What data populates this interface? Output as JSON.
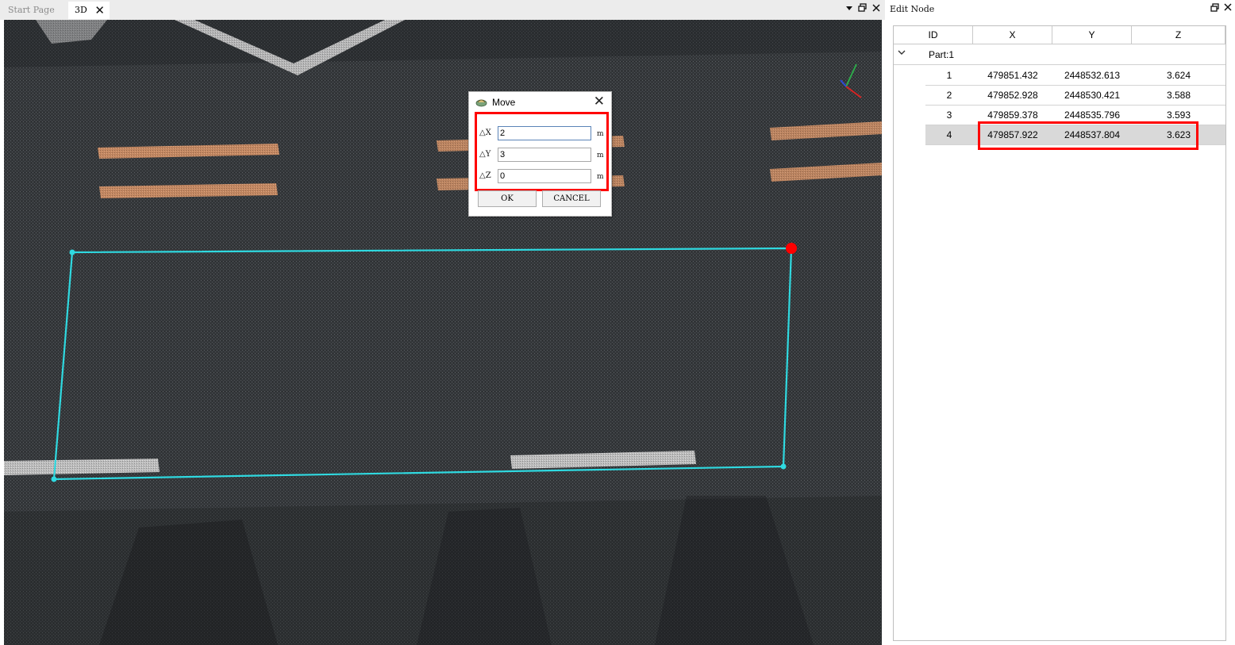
{
  "tabs": [
    {
      "label": "Start Page",
      "active": false
    },
    {
      "label": "3D",
      "active": true
    }
  ],
  "tab_close_glyph": "✕",
  "window_controls": {
    "dropdown_icon": "dropdown-arrow-icon",
    "restore_icon": "restore-window-icon",
    "close_icon": "close-icon"
  },
  "viewport": {
    "background_color": "#2f3134",
    "polygon_color": "#2fd9e0",
    "selected_vertex_color": "#ff0000",
    "marking_colors": {
      "orange": "#d6946b",
      "white": "#cfcfcf"
    }
  },
  "move_dialog": {
    "title": "Move",
    "fields": [
      {
        "label": "△X",
        "value": "2",
        "unit": "m"
      },
      {
        "label": "△Y",
        "value": "3",
        "unit": "m"
      },
      {
        "label": "△Z",
        "value": "0",
        "unit": "m"
      }
    ],
    "ok_label": "OK",
    "cancel_label": "CANCEL",
    "close_glyph": "✕"
  },
  "edit_node_panel": {
    "title": "Edit Node",
    "columns": [
      "ID",
      "X",
      "Y",
      "Z"
    ],
    "part_label": "Part:1",
    "rows": [
      {
        "id": "1",
        "x": "479851.432",
        "y": "2448532.613",
        "z": "3.624",
        "selected": false
      },
      {
        "id": "2",
        "x": "479852.928",
        "y": "2448530.421",
        "z": "3.588",
        "selected": false
      },
      {
        "id": "3",
        "x": "479859.378",
        "y": "2448535.796",
        "z": "3.593",
        "selected": false
      },
      {
        "id": "4",
        "x": "479857.922",
        "y": "2448537.804",
        "z": "3.623",
        "selected": true
      }
    ]
  },
  "highlight_color": "#ff0000"
}
